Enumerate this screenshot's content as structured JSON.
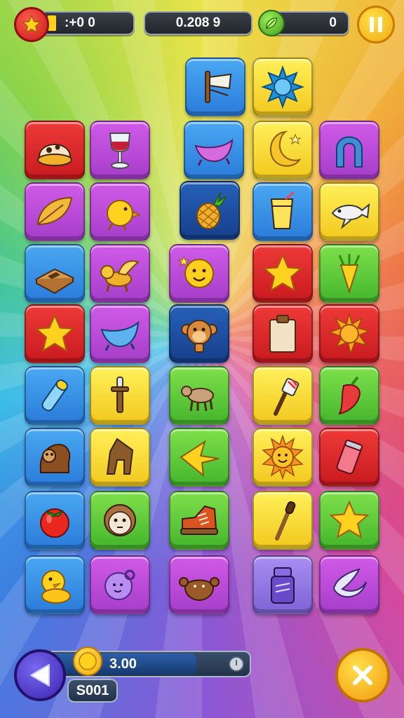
{
  "hud": {
    "left_counter": ":+0 0",
    "center_counter": "0.208 9",
    "right_counter": "0"
  },
  "bottom": {
    "amount": "3.00",
    "code": "S001"
  },
  "tiles": [
    {
      "icon": "feather-quill-icon",
      "color": "blue"
    },
    {
      "icon": "blue-sun-icon",
      "color": "yellow"
    },
    {
      "icon": "cream-dome-icon",
      "color": "red"
    },
    {
      "icon": "wine-glass-icon",
      "color": "purple"
    },
    {
      "icon": "boat-dish-icon",
      "color": "purple"
    },
    {
      "icon": "crescent-moon-icon",
      "color": "yellow"
    },
    {
      "icon": "horseshoe-magnet-icon",
      "color": "purple"
    },
    {
      "icon": "leaf-icon",
      "color": "purple"
    },
    {
      "icon": "chick-icon",
      "color": "purple"
    },
    {
      "icon": "pineapple-icon",
      "color": "navy"
    },
    {
      "icon": "juice-cup-icon",
      "color": "blue"
    },
    {
      "icon": "fish-icon",
      "color": "yellow"
    },
    {
      "icon": "book-icon",
      "color": "blue"
    },
    {
      "icon": "winged-lion-icon",
      "color": "purple"
    },
    {
      "icon": "smiley-face-icon",
      "color": "purple"
    },
    {
      "icon": "star-icon",
      "color": "red"
    },
    {
      "icon": "carrot-icon",
      "color": "green"
    },
    {
      "icon": "star-icon",
      "color": "red"
    },
    {
      "icon": "bowl-icon",
      "color": "purple"
    },
    {
      "icon": "monkey-face-icon",
      "color": "navy"
    },
    {
      "icon": "clipboard-icon",
      "color": "red"
    },
    {
      "icon": "sun-icon",
      "color": "red"
    },
    {
      "icon": "crayon-icon",
      "color": "blue"
    },
    {
      "icon": "dagger-icon",
      "color": "yellow"
    },
    {
      "icon": "goat-icon",
      "color": "green"
    },
    {
      "icon": "paintbrush-icon",
      "color": "yellow"
    },
    {
      "icon": "chili-pepper-icon",
      "color": "green"
    },
    {
      "icon": "hedgehog-icon",
      "color": "blue"
    },
    {
      "icon": "wooden-stool-icon",
      "color": "yellow"
    },
    {
      "icon": "yellow-bird-icon",
      "color": "green"
    },
    {
      "icon": "smiling-sun-icon",
      "color": "yellow"
    },
    {
      "icon": "soda-can-icon",
      "color": "red"
    },
    {
      "icon": "tomato-icon",
      "color": "blue"
    },
    {
      "icon": "monkey-head-icon",
      "color": "green"
    },
    {
      "icon": "sneaker-icon",
      "color": "green"
    },
    {
      "icon": "pipette-icon",
      "color": "yellow"
    },
    {
      "icon": "star-icon",
      "color": "green"
    },
    {
      "icon": "duckling-icon",
      "color": "blue"
    },
    {
      "icon": "ghost-blob-icon",
      "color": "purple"
    },
    {
      "icon": "crab-icon",
      "color": "purple"
    },
    {
      "icon": "jar-icon",
      "color": "lilac"
    },
    {
      "icon": "crescent-fish-icon",
      "color": "purple"
    }
  ]
}
